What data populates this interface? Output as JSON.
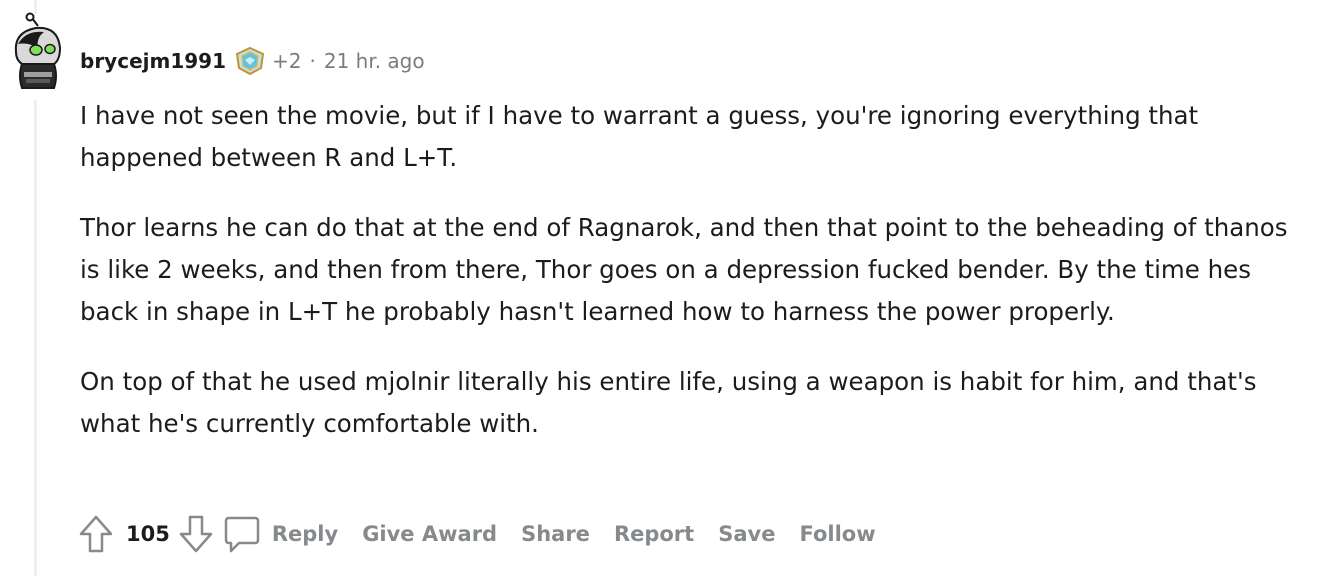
{
  "comment": {
    "username": "brycejm1991",
    "award_icon": "flair-badge-icon",
    "flair_count": "+2",
    "separator": "·",
    "timestamp": "21 hr. ago",
    "paragraphs": [
      "I have not seen the movie, but if I have to warrant a guess, you're ignoring everything that happened between R and L+T.",
      "Thor learns he can do that at the end of Ragnarok, and then that point to the beheading of thanos is like 2 weeks, and then from there, Thor goes on a depression fucked bender. By the time hes back in shape in L+T he probably hasn't learned how to harness the power properly.",
      "On top of that he used mjolnir literally his entire life, using a weapon is habit for him, and that's what he's currently comfortable with."
    ]
  },
  "actions": {
    "score": "105",
    "reply_label": "Reply",
    "give_award_label": "Give Award",
    "share_label": "Share",
    "report_label": "Report",
    "save_label": "Save",
    "follow_label": "Follow"
  },
  "colors": {
    "text": "#1c1c1c",
    "meta": "#7c7c7c",
    "action": "#878a8c",
    "thread_line": "#edeff1"
  }
}
